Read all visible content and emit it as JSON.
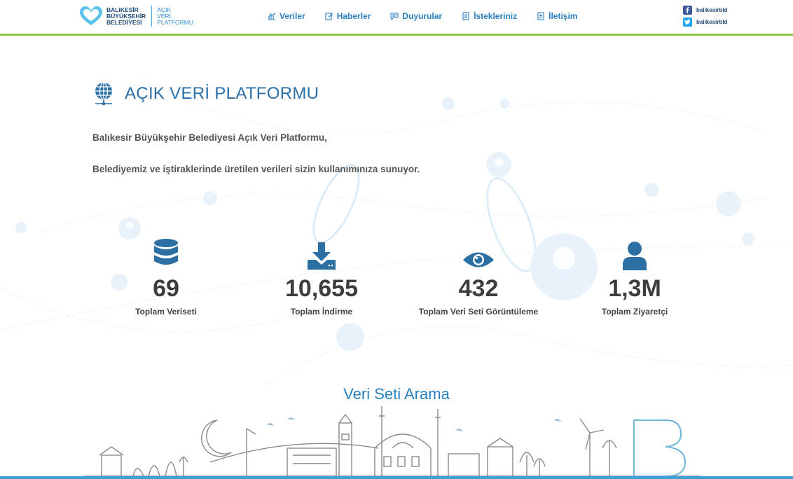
{
  "logo": {
    "org_lines": [
      "BALIKESİR",
      "BÜYÜKŞEHİR",
      "BELEDİYESİ"
    ],
    "platform_lines": [
      "AÇIK",
      "VERİ",
      "PLATFORMU"
    ]
  },
  "nav": {
    "items": [
      {
        "label": "Veriler",
        "icon": "chart-icon"
      },
      {
        "label": "Haberler",
        "icon": "edit-icon"
      },
      {
        "label": "Duyurular",
        "icon": "message-icon"
      },
      {
        "label": "İstekleriniz",
        "icon": "list-icon"
      },
      {
        "label": "İletişim",
        "icon": "contact-icon"
      }
    ]
  },
  "social": {
    "facebook": "balikesirbld",
    "twitter": "balikesirbld"
  },
  "main": {
    "title": "AÇIK VERİ PLATFORMU",
    "intro_line1": "Balıkesir Büyükşehir Belediyesi Açık Veri Platformu,",
    "intro_line2": "Belediyemiz ve iştiraklerinde üretilen verileri sizin kullanımınıza sunuyor."
  },
  "stats": [
    {
      "value": "69",
      "label": "Toplam Veriseti",
      "icon": "database-icon"
    },
    {
      "value": "10,655",
      "label": "Toplam İndirme",
      "icon": "download-icon"
    },
    {
      "value": "432",
      "label": "Toplam Veri Seti Görüntüleme",
      "icon": "eye-icon"
    },
    {
      "value": "1,3M",
      "label": "Toplam Ziyaretçi",
      "icon": "user-icon"
    }
  ],
  "search": {
    "title": "Veri Seti Arama"
  },
  "colors": {
    "brand_blue": "#2a7fbf",
    "dark_navy": "#1f4e79",
    "stat_icon": "#2c6fa3",
    "header_border": "#8cc63f",
    "bottom_bar": "#3f9fd6"
  }
}
